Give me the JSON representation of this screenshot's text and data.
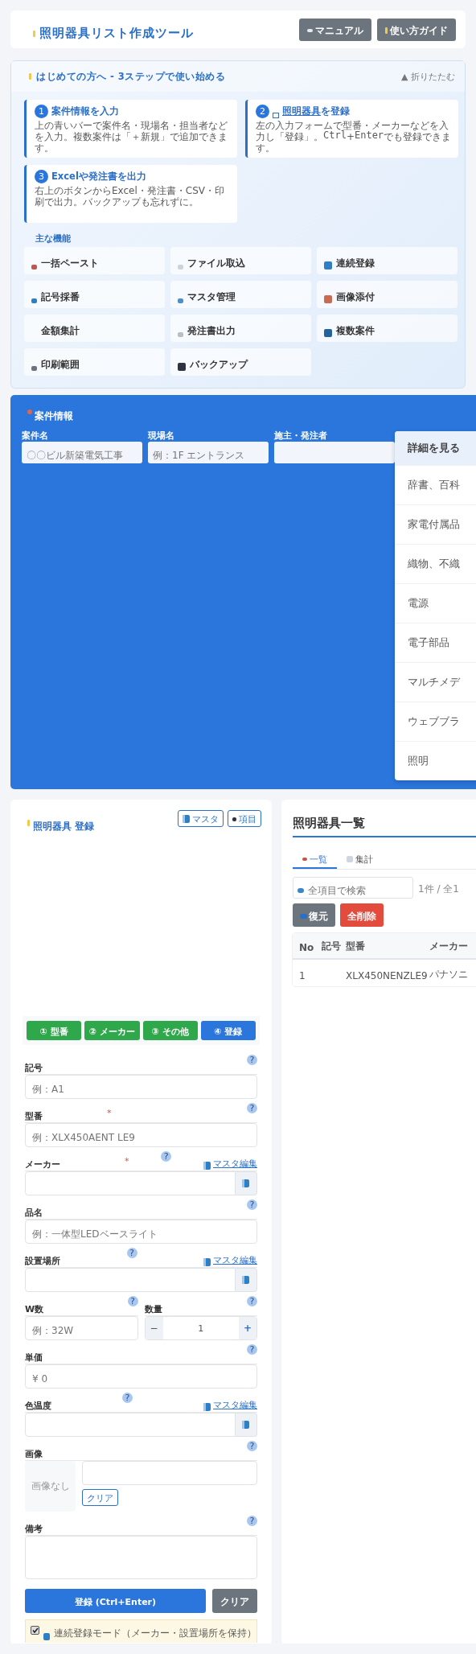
{
  "header": {
    "title": "照明器具リスト作成ツール",
    "buttons": [
      {
        "label": "マニュアル"
      },
      {
        "label": "使い方ガイド"
      }
    ]
  },
  "guide": {
    "title": "はじめての方へ - 3ステップで使い始める",
    "collapse": "▲ 折りたたむ",
    "steps": [
      {
        "number": "1",
        "title": "案件情報を入力",
        "description": "上の青いバーで案件名・現場名・担当者などを入力。複数案件は「＋新規」で追加できます。"
      },
      {
        "number": "2",
        "link": "照明器具",
        "title": "を登録",
        "description": "左の入力フォームで型番・メーカーなどを入力し「登録」。$^{Ctrl}$+$^{Enter}$でも登録できます。"
      },
      {
        "number": "3",
        "title": "Excelや発注書を出力",
        "description": "右上のボタンからExcel・発注書・CSV・印刷で出力。バックアップも忘れずに。"
      }
    ],
    "features_title": "主な機能",
    "features": [
      "一括ペースト",
      "ファイル取込",
      "連続登録",
      "記号採番",
      "マスタ管理",
      "画像添付",
      "金額集計",
      "発注書出力",
      "複数案件",
      "印刷範囲",
      "バックアップ"
    ]
  },
  "project": {
    "title": "案件情報",
    "fields": [
      {
        "label": "案件名",
        "placeholder": "〇〇ビル新築電気工事"
      },
      {
        "label": "現場名",
        "placeholder": "例：1F エントランス"
      },
      {
        "label": "施主・発注者"
      }
    ]
  },
  "dropdown": {
    "header": "詳細を見る",
    "items": [
      "辞書、百科",
      "家電付属品",
      "織物、不織",
      "電源",
      "電子部品",
      "マルチメデ",
      "ウェブブラ",
      "照明"
    ]
  },
  "form": {
    "title": "照明器具 登録",
    "tools": [
      {
        "label": "マスタ"
      },
      {
        "label": "項目"
      }
    ],
    "steps": [
      {
        "label": "① 型番",
        "selected": false
      },
      {
        "label": "② メーカー",
        "selected": false
      },
      {
        "label": "③ その他",
        "selected": false
      },
      {
        "label": "④ 登録",
        "selected": true
      }
    ],
    "fields": [
      {
        "kind": "text",
        "label": "記号",
        "help": "?",
        "placeholder": "例：A1"
      },
      {
        "kind": "text",
        "label": "型番",
        "required_mark": "*",
        "help": "?",
        "placeholder": "例：XLX450AENT LE9"
      },
      {
        "kind": "select",
        "label": "メーカー",
        "required_mark": "*",
        "help": "?",
        "link": "マスタ編集"
      },
      {
        "kind": "text",
        "label": "品名",
        "help": "?",
        "placeholder": "例：一体型LEDベースライト"
      },
      {
        "kind": "select",
        "label": "設置場所",
        "help": "?",
        "link": "マスタ編集"
      },
      {
        "kind": "pair",
        "items": [
          {
            "label": "W数",
            "help": "?",
            "placeholder": "例：32W"
          },
          {
            "label": "数量",
            "help": "?",
            "minus": "−",
            "value": "1",
            "plus": "+"
          }
        ]
      },
      {
        "kind": "text",
        "label": "単価",
        "help": "?",
        "placeholder": "¥ 0"
      },
      {
        "kind": "select",
        "label": "色温度",
        "help": "?",
        "link": "マスタ編集"
      },
      {
        "kind": "image",
        "label": "画像",
        "help": "?",
        "preview": "画像なし",
        "clear": "クリア"
      },
      {
        "kind": "textarea",
        "label": "備考",
        "help": "?"
      }
    ],
    "submit": "登録 (Ctrl+Enter)",
    "clear": "クリア",
    "continuous": {
      "checked": true,
      "label": "連続登録モード（メーカー・設置場所を保持）"
    }
  },
  "list": {
    "title": "照明器具一覧",
    "tabs": [
      {
        "label": "一覧",
        "selected": true
      },
      {
        "label": "集計",
        "selected": false
      }
    ],
    "search_placeholder": "全項目で検索",
    "count": "1件 / 全1",
    "buttons": [
      {
        "kind": "restore",
        "label": "復元"
      },
      {
        "kind": "delete",
        "label": "全削除"
      }
    ],
    "columns": [
      "No",
      "記号",
      "型番",
      "メーカー"
    ],
    "rows": [
      [
        "1",
        null,
        "XLX450NENZLE9",
        "パナソニ"
      ]
    ]
  }
}
